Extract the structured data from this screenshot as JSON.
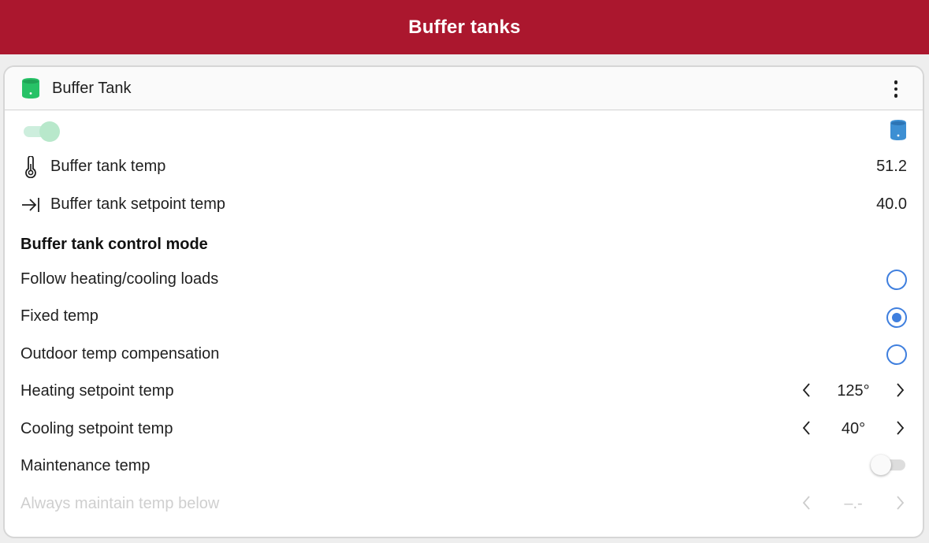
{
  "app": {
    "title": "Buffer tanks"
  },
  "card": {
    "title": "Buffer Tank",
    "header_icon": "buffer-tank-icon",
    "menu_icon": "more-vert-icon",
    "enabled": true,
    "status_icon": "buffer-tank-status-icon"
  },
  "sensors": [
    {
      "icon": "thermometer-icon",
      "label": "Buffer tank temp",
      "value": "51.2"
    },
    {
      "icon": "arrow-to-right-icon",
      "label": "Buffer tank setpoint temp",
      "value": "40.0"
    }
  ],
  "control_mode": {
    "title": "Buffer tank control mode",
    "options": [
      {
        "label": "Follow heating/cooling loads",
        "selected": false
      },
      {
        "label": "Fixed temp",
        "selected": true
      },
      {
        "label": "Outdoor temp compensation",
        "selected": false
      }
    ]
  },
  "setpoints": {
    "heating": {
      "label": "Heating setpoint temp",
      "value": "125°"
    },
    "cooling": {
      "label": "Cooling setpoint temp",
      "value": "40°"
    }
  },
  "maintenance": {
    "label": "Maintenance temp",
    "enabled": false
  },
  "maintain_below": {
    "label": "Always maintain temp below",
    "value": "–.-",
    "disabled": true
  },
  "colors": {
    "header_bg": "#ab172e",
    "tank_green": "#27c267",
    "tank_blue": "#3d8fd3",
    "radio_blue": "#3f7fde",
    "toggle_on": "#b8e8cb"
  }
}
